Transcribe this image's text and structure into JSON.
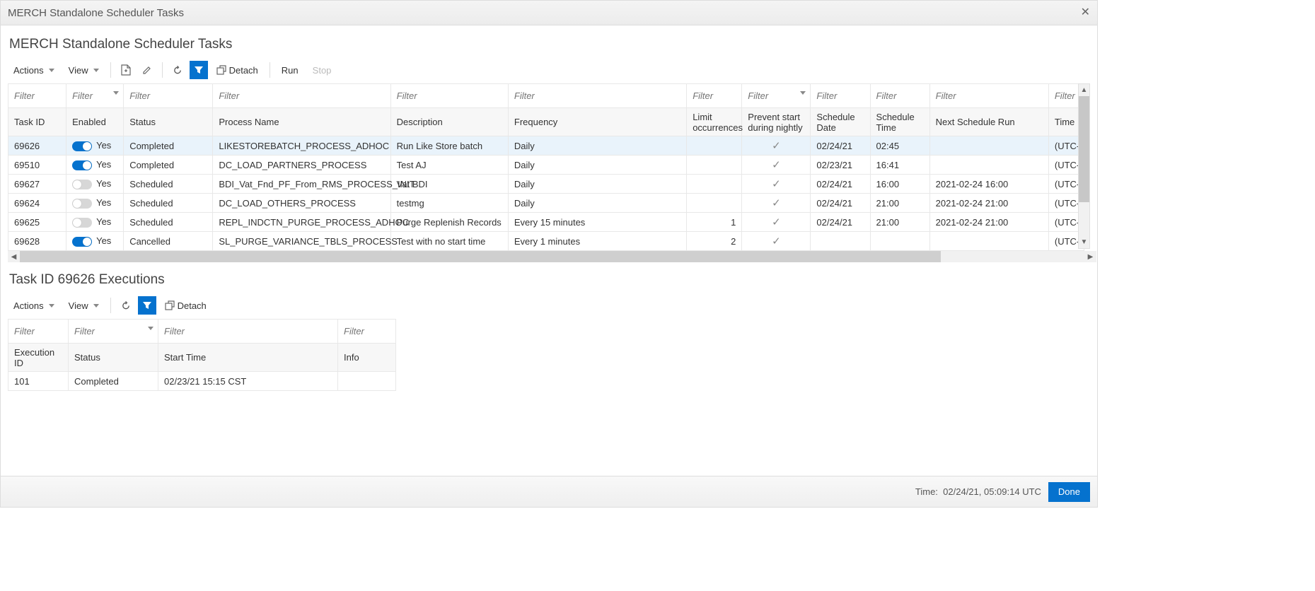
{
  "dialog": {
    "title": "MERCH Standalone Scheduler Tasks"
  },
  "section1": {
    "title": "MERCH Standalone Scheduler Tasks",
    "toolbar": {
      "actions": "Actions",
      "view": "View",
      "detach": "Detach",
      "run": "Run",
      "stop": "Stop"
    },
    "columns": {
      "task_id": "Task ID",
      "enabled": "Enabled",
      "status": "Status",
      "process_name": "Process Name",
      "description": "Description",
      "frequency": "Frequency",
      "limit_occurrences": "Limit occurrences",
      "prevent_start": "Prevent start during nightly",
      "schedule_date": "Schedule Date",
      "schedule_time": "Schedule Time",
      "next_run": "Next Schedule Run",
      "time": "Time"
    },
    "filter_placeholder": "Filter",
    "rows": [
      {
        "task_id": "69626",
        "enabled": true,
        "enabled_label": "Yes",
        "status": "Completed",
        "process": "LIKESTOREBATCH_PROCESS_ADHOC",
        "desc": "Run Like Store batch",
        "freq": "Daily",
        "limit": "",
        "prevent": true,
        "date": "02/24/21",
        "time": "02:45",
        "next": "",
        "tz": "(UTC-"
      },
      {
        "task_id": "69510",
        "enabled": true,
        "enabled_label": "Yes",
        "status": "Completed",
        "process": "DC_LOAD_PARTNERS_PROCESS",
        "desc": "Test AJ",
        "freq": "Daily",
        "limit": "",
        "prevent": true,
        "date": "02/23/21",
        "time": "16:41",
        "next": "",
        "tz": "(UTC-"
      },
      {
        "task_id": "69627",
        "enabled": false,
        "enabled_label": "Yes",
        "status": "Scheduled",
        "process": "BDI_Vat_Fnd_PF_From_RMS_PROCESS_INIT",
        "desc": "Vat BDI",
        "freq": "Daily",
        "limit": "",
        "prevent": true,
        "date": "02/24/21",
        "time": "16:00",
        "next": "2021-02-24 16:00",
        "tz": "(UTC-"
      },
      {
        "task_id": "69624",
        "enabled": false,
        "enabled_label": "Yes",
        "status": "Scheduled",
        "process": "DC_LOAD_OTHERS_PROCESS",
        "desc": "testmg",
        "freq": "Daily",
        "limit": "",
        "prevent": true,
        "date": "02/24/21",
        "time": "21:00",
        "next": "2021-02-24 21:00",
        "tz": "(UTC-"
      },
      {
        "task_id": "69625",
        "enabled": false,
        "enabled_label": "Yes",
        "status": "Scheduled",
        "process": "REPL_INDCTN_PURGE_PROCESS_ADHOC",
        "desc": "Purge Replenish Records",
        "freq": "Every 15 minutes",
        "limit": "1",
        "prevent": true,
        "date": "02/24/21",
        "time": "21:00",
        "next": "2021-02-24 21:00",
        "tz": "(UTC-"
      },
      {
        "task_id": "69628",
        "enabled": true,
        "enabled_label": "Yes",
        "status": "Cancelled",
        "process": "SL_PURGE_VARIANCE_TBLS_PROCESS",
        "desc": "Test with no start time",
        "freq": "Every 1 minutes",
        "limit": "2",
        "prevent": true,
        "date": "",
        "time": "",
        "next": "",
        "tz": "(UTC-"
      }
    ]
  },
  "section2": {
    "title": "Task ID 69626 Executions",
    "toolbar": {
      "actions": "Actions",
      "view": "View",
      "detach": "Detach"
    },
    "columns": {
      "exec_id": "Execution ID",
      "status": "Status",
      "start_time": "Start Time",
      "info": "Info"
    },
    "filter_placeholder": "Filter",
    "rows": [
      {
        "exec_id": "101",
        "status": "Completed",
        "start_time": "02/23/21 15:15 CST",
        "info": ""
      }
    ]
  },
  "footer": {
    "time_label": "Time:",
    "time_value": "02/24/21, 05:09:14 UTC",
    "done": "Done"
  }
}
